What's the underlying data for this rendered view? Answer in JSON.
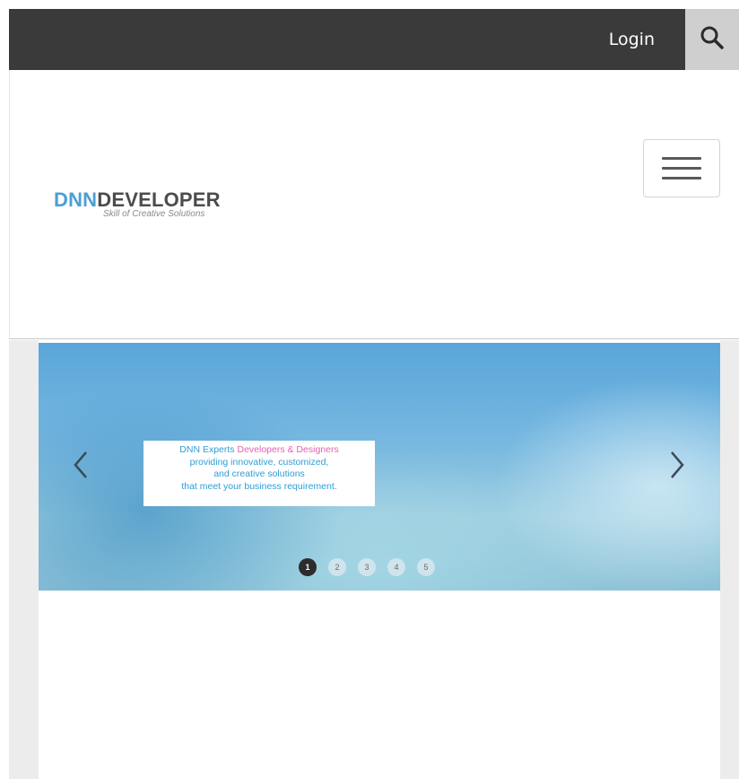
{
  "topbar": {
    "login_label": "Login",
    "search_icon": "search-icon"
  },
  "logo": {
    "brand_part1": "DNN",
    "brand_part2": "DEVELOPER",
    "tagline": "Skill of Creative Solutions"
  },
  "menu": {
    "toggle_icon": "hamburger-menu-icon"
  },
  "slider": {
    "caption_line1_a": "DNN Experts ",
    "caption_line1_b": "Developers & Designers",
    "caption_line2": "providing innovative, customized,",
    "caption_line3": "and creative solutions",
    "caption_line4": "that meet your business requirement.",
    "prev_icon": "chevron-left-icon",
    "next_icon": "chevron-right-icon",
    "dots": [
      "1",
      "2",
      "3",
      "4",
      "5"
    ],
    "active_dot": "1"
  },
  "colors": {
    "topbar_bg": "#3a3a3a",
    "search_bg": "#cfcfcf",
    "brand_blue": "#4a9fd6",
    "brand_dark": "#4c4c4c",
    "caption_blue": "#2e9fd6",
    "caption_pink": "#e65fb5"
  }
}
